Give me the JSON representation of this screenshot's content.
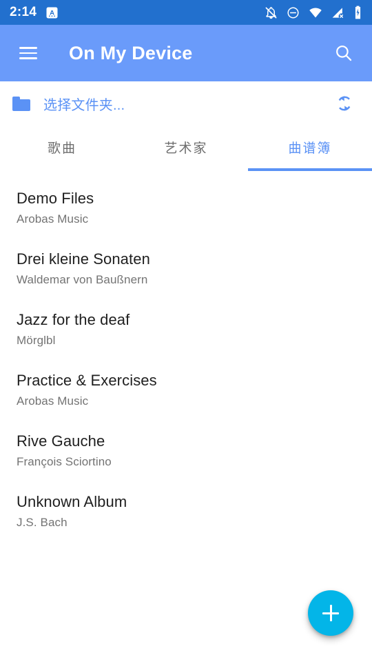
{
  "status_bar": {
    "time": "2:14",
    "background_color": "#2270CE",
    "icons": [
      {
        "name": "notification-app-icon",
        "glyph": "A"
      },
      {
        "name": "notifications-silenced-icon"
      },
      {
        "name": "do-not-disturb-icon"
      },
      {
        "name": "wifi-icon"
      },
      {
        "name": "cell-signal-off-icon"
      },
      {
        "name": "battery-charging-icon"
      }
    ]
  },
  "app_bar": {
    "title": "On My Device",
    "background_color": "#6A9BFA",
    "menu_icon": "hamburger-menu-icon",
    "search_icon": "search-icon"
  },
  "folder_row": {
    "label": "选择文件夹...",
    "folder_icon": "folder-icon",
    "refresh_icon": "refresh-sync-icon",
    "accent_color": "#5B92F5"
  },
  "tabs": {
    "items": [
      {
        "label": "歌曲",
        "active": false
      },
      {
        "label": "艺术家",
        "active": false
      },
      {
        "label": "曲谱簿",
        "active": true
      }
    ],
    "indicator_color": "#5B92F5"
  },
  "list": {
    "items": [
      {
        "title": "Demo Files",
        "subtitle": "Arobas Music"
      },
      {
        "title": "Drei kleine Sonaten",
        "subtitle": "Waldemar von Baußnern"
      },
      {
        "title": "Jazz for the deaf",
        "subtitle": "Mörglbl"
      },
      {
        "title": "Practice & Exercises",
        "subtitle": "Arobas Music"
      },
      {
        "title": "Rive Gauche",
        "subtitle": "François Sciortino"
      },
      {
        "title": "Unknown Album",
        "subtitle": "J.S. Bach"
      }
    ]
  },
  "fab": {
    "icon": "plus-icon",
    "background_color": "#03B5E8"
  }
}
